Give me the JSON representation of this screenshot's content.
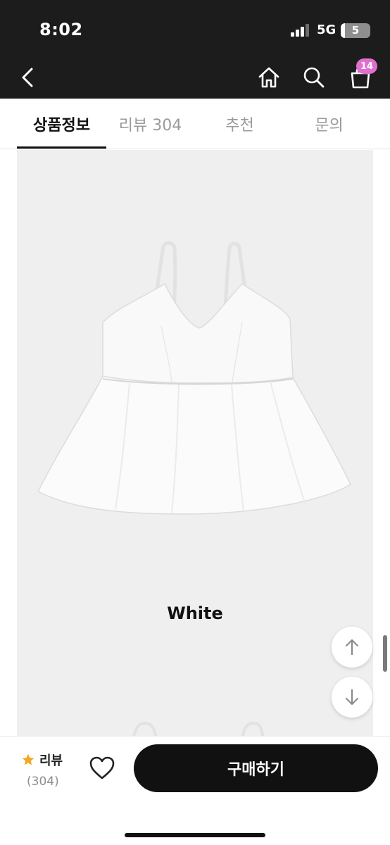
{
  "status_bar": {
    "time": "8:02",
    "network": "5G",
    "battery": "5"
  },
  "header": {
    "back_icon": "chevron-left-icon",
    "home_icon": "home-icon",
    "search_icon": "search-icon",
    "cart_icon": "shopping-bag-icon",
    "cart_badge": "14",
    "badge_color": "#e16fd0"
  },
  "tabs": [
    {
      "label": "상품정보",
      "active": true
    },
    {
      "label": "리뷰 304",
      "active": false
    },
    {
      "label": "추천",
      "active": false
    },
    {
      "label": "문의",
      "active": false
    }
  ],
  "product": {
    "color_label": "White",
    "image_background": "#efefef"
  },
  "scroll_buttons": {
    "up_icon": "arrow-up-icon",
    "down_icon": "arrow-down-icon"
  },
  "bottom_bar": {
    "review_label": "리뷰",
    "review_count": "(304)",
    "star_color": "#f5a623",
    "wishlist_icon": "heart-icon",
    "buy_label": "구매하기"
  }
}
